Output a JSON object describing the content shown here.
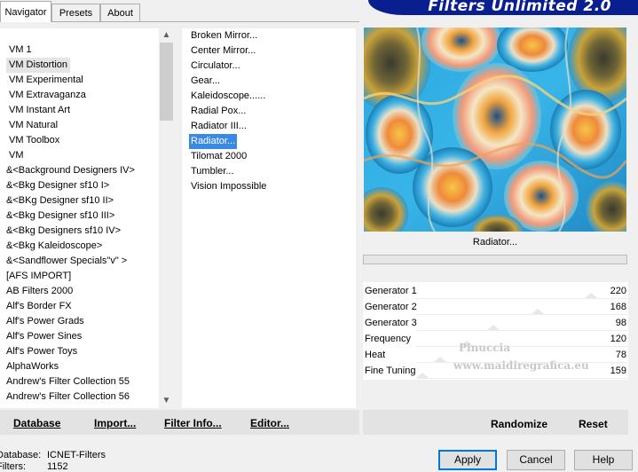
{
  "tabs": [
    "Navigator",
    "Presets",
    "About"
  ],
  "banner_title": "Filters Unlimited 2.0",
  "categories": [
    "VM 1",
    "VM Distortion",
    "VM Experimental",
    "VM Extravaganza",
    "VM Instant Art",
    "VM Natural",
    "VM Toolbox",
    "VM",
    "&<Background Designers IV>",
    "&<Bkg Designer sf10 I>",
    "&<BKg Designer sf10 II>",
    "&<Bkg Designer sf10 III>",
    "&<Bkg Designers sf10 IV>",
    "&<Bkg Kaleidoscope>",
    "&<Sandflower Specials\"v\" >",
    "[AFS IMPORT]",
    "AB Filters 2000",
    "Alf's Border FX",
    "Alf's Power Grads",
    "Alf's Power Sines",
    "Alf's Power Toys",
    "AlphaWorks",
    "Andrew's Filter Collection 55",
    "Andrew's Filter Collection 56"
  ],
  "selected_category": "VM Distortion",
  "filters": [
    "Broken Mirror...",
    "Center Mirror...",
    "Circulator...",
    "Gear...",
    "Kaleidoscope......",
    "Radial Pox...",
    "Radiator III...",
    "Radiator...",
    "Tilomat 2000",
    "Tumbler...",
    "Vision Impossible"
  ],
  "selected_filter": "Radiator...",
  "scroll_icons": {
    "up": "chevron-up-icon",
    "down": "chevron-down-icon"
  },
  "left_buttons": {
    "database": "Database",
    "import": "Import...",
    "filter_info": "Filter Info...",
    "editor": "Editor..."
  },
  "preview_label": "Radiator...",
  "progress": 0,
  "parameters": [
    {
      "name": "Generator 1",
      "value": "220"
    },
    {
      "name": "Generator 2",
      "value": "168"
    },
    {
      "name": "Generator 3",
      "value": "98"
    },
    {
      "name": "Frequency",
      "value": "120"
    },
    {
      "name": "Heat",
      "value": "78"
    },
    {
      "name": "Fine Tuning",
      "value": "159"
    }
  ],
  "watermark": {
    "line1": "Pinuccia",
    "line2": "www.maidiregrafica.eu"
  },
  "right_buttons": {
    "randomize": "Randomize",
    "reset": "Reset"
  },
  "status": {
    "database_label": "Database:",
    "database_value": "ICNET-Filters",
    "filters_label": "Filters:",
    "filters_value": "1152"
  },
  "dialog_buttons": {
    "apply": "Apply",
    "cancel": "Cancel",
    "help": "Help"
  },
  "colors": {
    "selection": "#3a8ae3",
    "banner": "#0a1f8f",
    "apply_border": "#0078d7"
  }
}
